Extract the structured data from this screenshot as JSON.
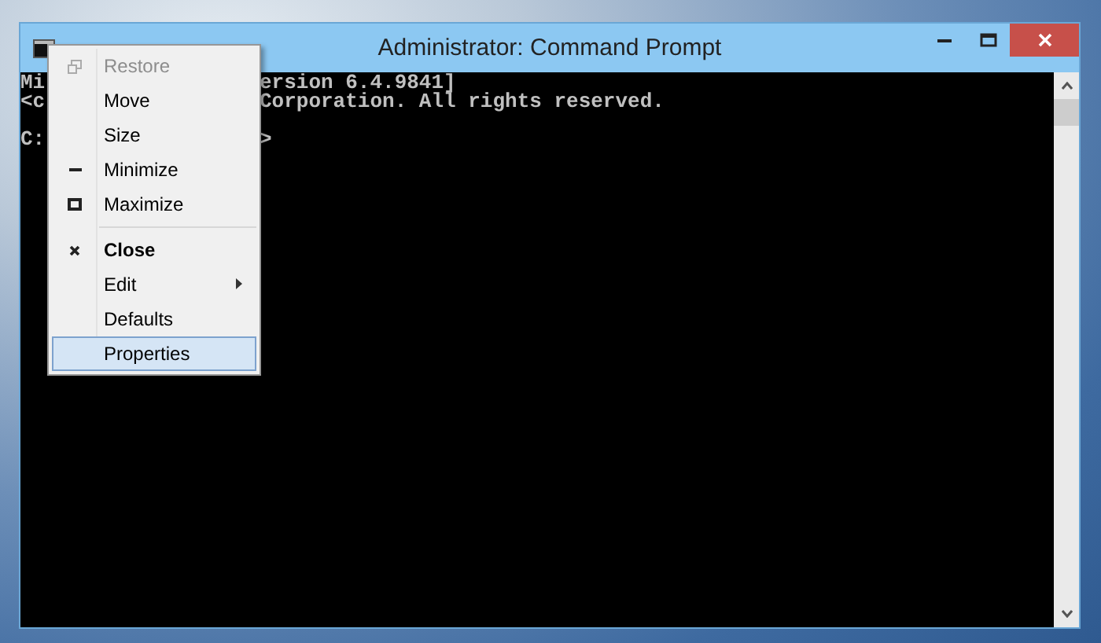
{
  "window": {
    "title": "Administrator: Command Prompt"
  },
  "console": {
    "blocks": [
      {
        "lines": [
          {
            "left": "Mi",
            "right": "ersion 6.4.9841]"
          },
          {
            "left": "<c",
            "right": "Corporation. All rights reserved."
          }
        ]
      },
      {
        "lines": [
          {
            "left": "C:",
            "right": ">"
          }
        ]
      }
    ]
  },
  "system_menu": {
    "items": [
      {
        "kind": "restore",
        "label": "Restore",
        "disabled": true,
        "default": false,
        "selected": false
      },
      {
        "kind": "plain",
        "label": "Move",
        "disabled": false,
        "default": false,
        "selected": false
      },
      {
        "kind": "plain",
        "label": "Size",
        "disabled": false,
        "default": false,
        "selected": false
      },
      {
        "kind": "minimize",
        "label": "Minimize",
        "disabled": false,
        "default": false,
        "selected": false
      },
      {
        "kind": "maximize",
        "label": "Maximize",
        "disabled": false,
        "default": false,
        "selected": false
      },
      {
        "kind": "separator"
      },
      {
        "kind": "close",
        "label": "Close",
        "disabled": false,
        "default": true,
        "selected": false
      },
      {
        "kind": "submenu",
        "label": "Edit",
        "disabled": false,
        "default": false,
        "selected": false
      },
      {
        "kind": "plain",
        "label": "Defaults",
        "disabled": false,
        "default": false,
        "selected": false
      },
      {
        "kind": "plain",
        "label": "Properties",
        "disabled": false,
        "default": false,
        "selected": true
      }
    ]
  }
}
